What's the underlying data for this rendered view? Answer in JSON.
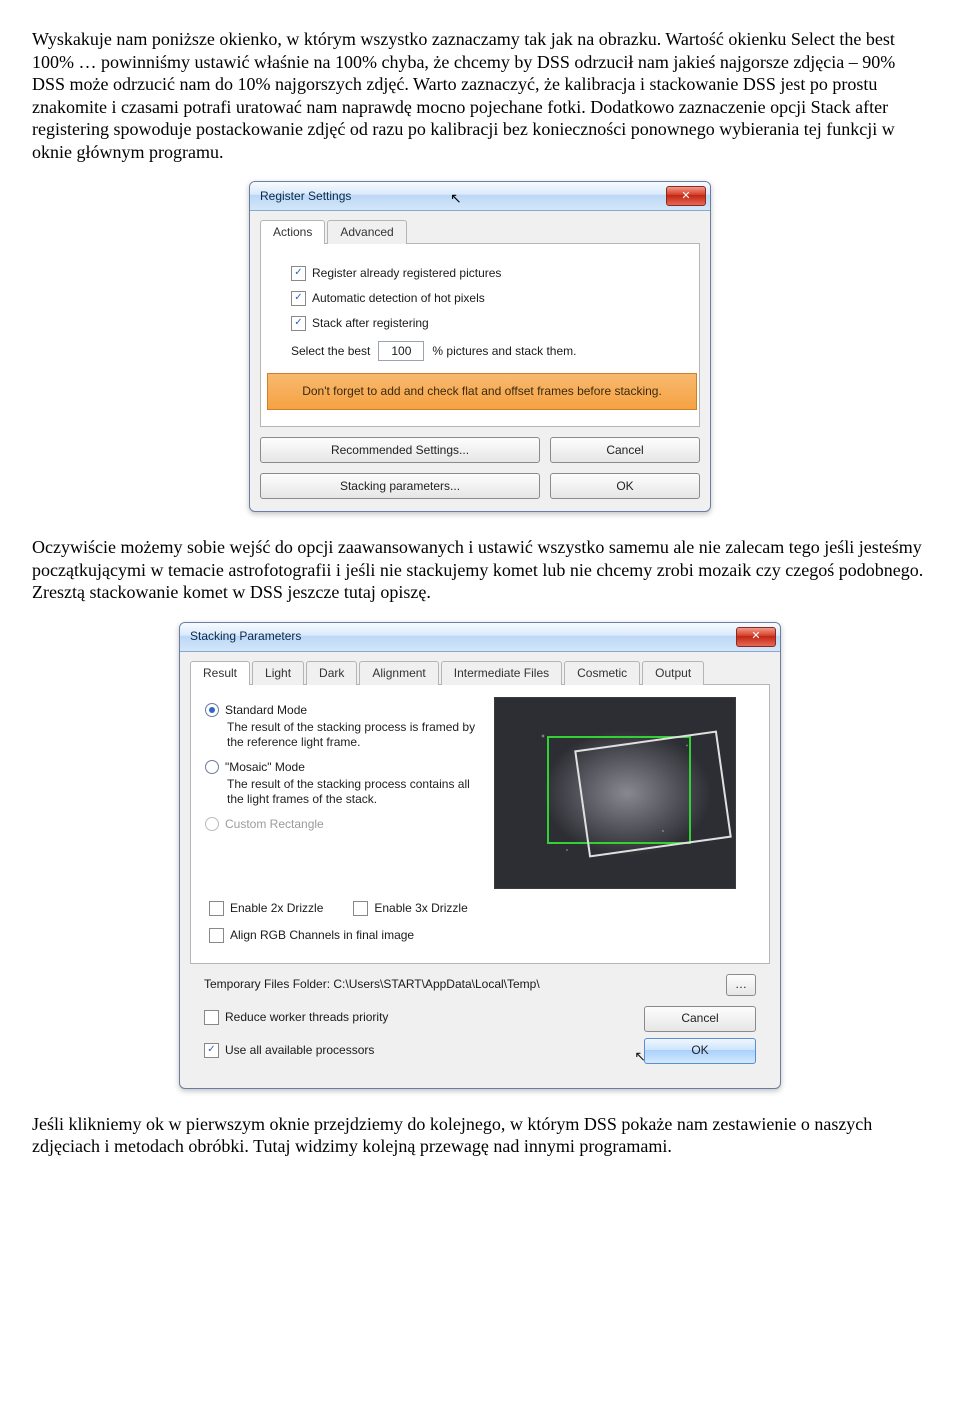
{
  "para1": "Wyskakuje nam poniższe okienko, w którym wszystko zaznaczamy tak jak na obrazku. Wartość okienku Select the best 100% … powinniśmy ustawić właśnie na 100% chyba, że chcemy by DSS odrzucił nam jakieś najgorsze zdjęcia – 90% DSS może odrzucić nam do 10% najgorszych zdjęć. Warto zaznaczyć, że kalibracja i stackowanie DSS jest po prostu znakomite i czasami potrafi uratować nam naprawdę mocno pojechane fotki. Dodatkowo zaznaczenie opcji Stack after registering spowoduje postackowanie zdjęć od razu po kalibracji bez konieczności ponownego wybierania tej funkcji w oknie głównym programu.",
  "para2": "Oczywiście możemy sobie wejść do opcji zaawansowanych i ustawić wszystko samemu ale nie zalecam tego jeśli jesteśmy początkującymi w temacie astrofotografii i jeśli nie stackujemy komet lub nie chcemy zrobi mozaik czy czegoś podobnego. Zresztą stackowanie komet w DSS jeszcze tutaj opiszę.",
  "para3": "Jeśli klikniemy ok w pierwszym oknie przejdziemy do kolejnego, w którym DSS pokaże nam zestawienie o naszych zdjęciach i metodach obróbki. Tutaj widzimy kolejną przewagę nad innymi programami.",
  "reg": {
    "title": "Register Settings",
    "tabs": {
      "actions": "Actions",
      "advanced": "Advanced"
    },
    "chk1": "Register already registered pictures",
    "chk2": "Automatic detection of hot pixels",
    "chk3": "Stack after registering",
    "sel_a": "Select the best",
    "sel_val": "100",
    "sel_b": "% pictures and stack them.",
    "warn": "Don't forget to add and check flat and offset frames before stacking.",
    "btn_rec": "Recommended Settings...",
    "btn_stack": "Stacking parameters...",
    "btn_cancel": "Cancel",
    "btn_ok": "OK"
  },
  "sp": {
    "title": "Stacking Parameters",
    "tabs": {
      "result": "Result",
      "light": "Light",
      "dark": "Dark",
      "alignment": "Alignment",
      "inter": "Intermediate Files",
      "cosmetic": "Cosmetic",
      "output": "Output"
    },
    "std_mode": "Standard Mode",
    "std_desc": "The result of the stacking process is framed by the reference light frame.",
    "mos_mode": "\"Mosaic\" Mode",
    "mos_desc": "The result of the stacking process contains all the light frames of the stack.",
    "cust": "Custom Rectangle",
    "drz2": "Enable 2x Drizzle",
    "drz3": "Enable 3x Drizzle",
    "align": "Align RGB Channels in final image",
    "tmp": "Temporary Files Folder: C:\\Users\\START\\AppData\\Local\\Temp\\",
    "reduce": "Reduce worker threads priority",
    "useall": "Use all available processors",
    "cancel": "Cancel",
    "ok": "OK"
  }
}
